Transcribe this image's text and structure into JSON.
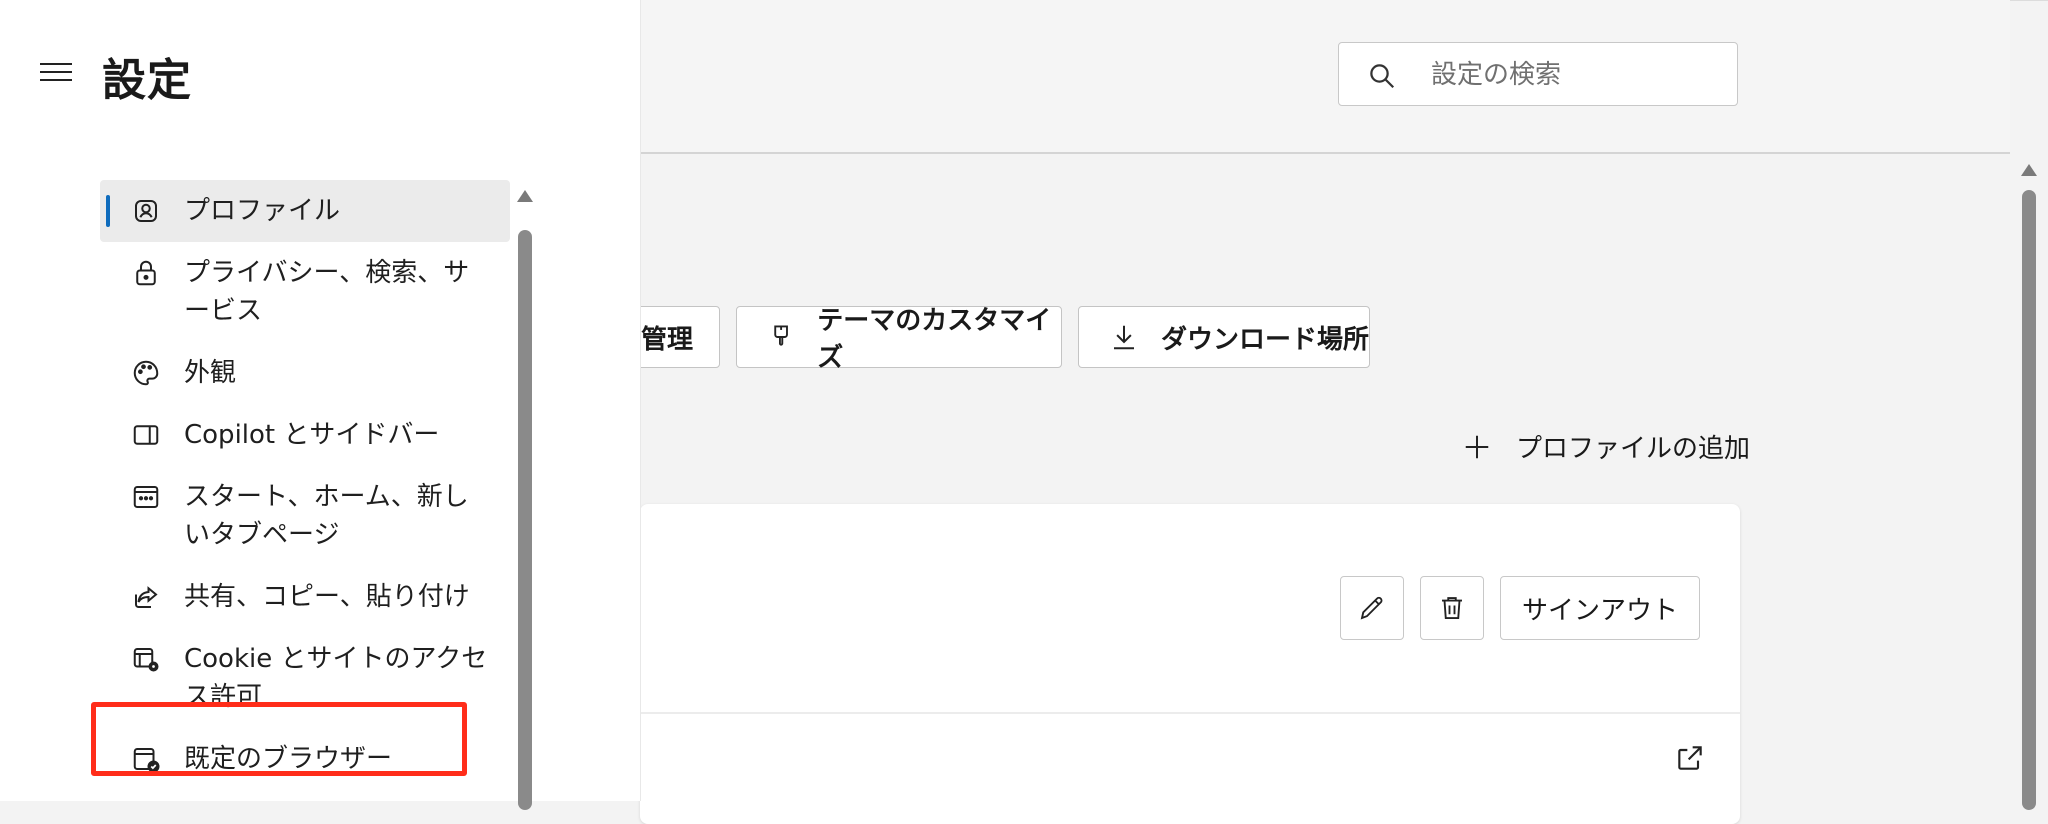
{
  "app": {
    "title": "設定"
  },
  "search": {
    "placeholder": "設定の検索"
  },
  "sidebar": {
    "items": [
      {
        "label": "プロファイル",
        "icon": "profile-icon",
        "active": true
      },
      {
        "label": "プライバシー、検索、サービス",
        "icon": "lock-icon"
      },
      {
        "label": "外観",
        "icon": "palette-icon"
      },
      {
        "label": "Copilot とサイドバー",
        "icon": "sidebar-icon"
      },
      {
        "label": "スタート、ホーム、新しいタブページ",
        "icon": "new-tab-icon"
      },
      {
        "label": "共有、コピー、貼り付け",
        "icon": "share-icon"
      },
      {
        "label": "Cookie とサイトのアクセス許可",
        "icon": "site-permissions-icon"
      },
      {
        "label": "既定のブラウザー",
        "icon": "default-browser-icon"
      }
    ]
  },
  "main": {
    "buttons": {
      "manage": "管理",
      "theme": "テーマのカスタマイズ",
      "download": "ダウンロード場所"
    },
    "add_profile": "プロファイルの追加",
    "sign_out": "サインアウト"
  },
  "colors": {
    "accent": "#0f6cbd",
    "highlight": "#ff2d1a"
  }
}
